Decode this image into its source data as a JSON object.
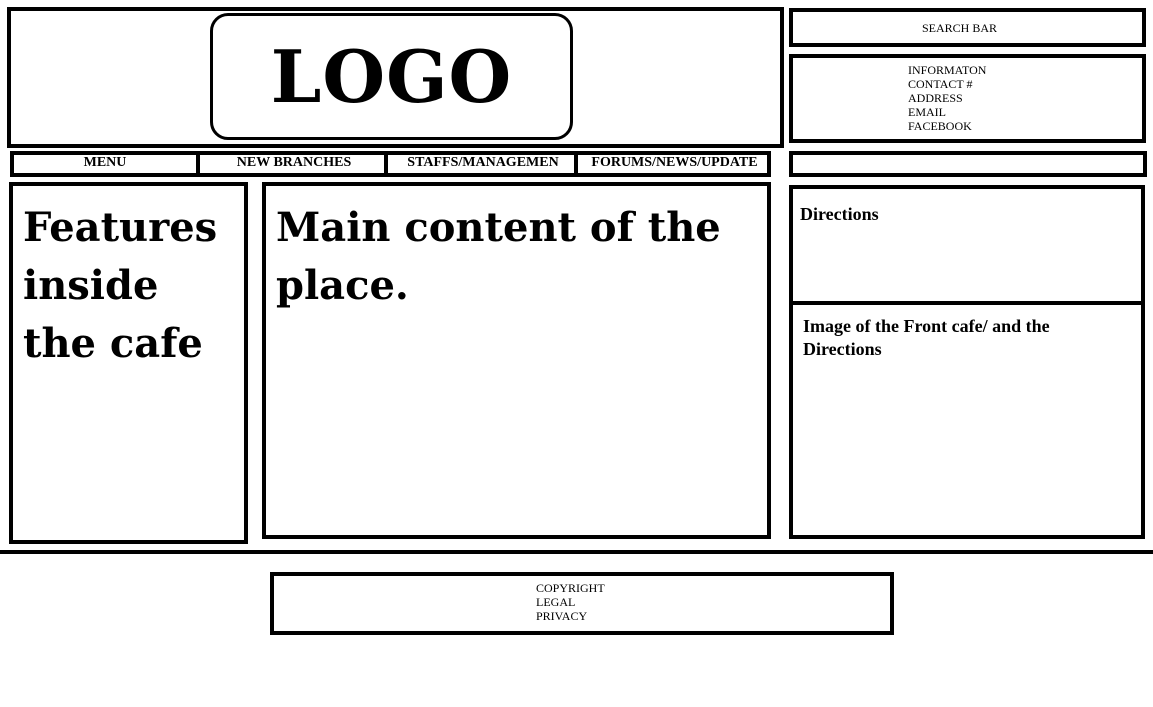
{
  "header": {
    "logo": "LOGO"
  },
  "search": {
    "label": "SEARCH BAR"
  },
  "info": {
    "lines": [
      "INFORMATON",
      "CONTACT #",
      "ADDRESS",
      "EMAIL",
      "FACEBOOK"
    ]
  },
  "nav": {
    "items": [
      "MENU",
      "NEW BRANCHES",
      "STAFFS/MANAGEMEN",
      "FORUMS/NEWS/UPDATE"
    ]
  },
  "left": {
    "text": "Features inside the cafe"
  },
  "main": {
    "text": "Main content of the place."
  },
  "right": {
    "directions": "Directions",
    "image": "Image of the Front cafe/ and the Directions"
  },
  "footer": {
    "lines": [
      "COPYRIGHT",
      "LEGAL",
      "PRIVACY"
    ]
  }
}
